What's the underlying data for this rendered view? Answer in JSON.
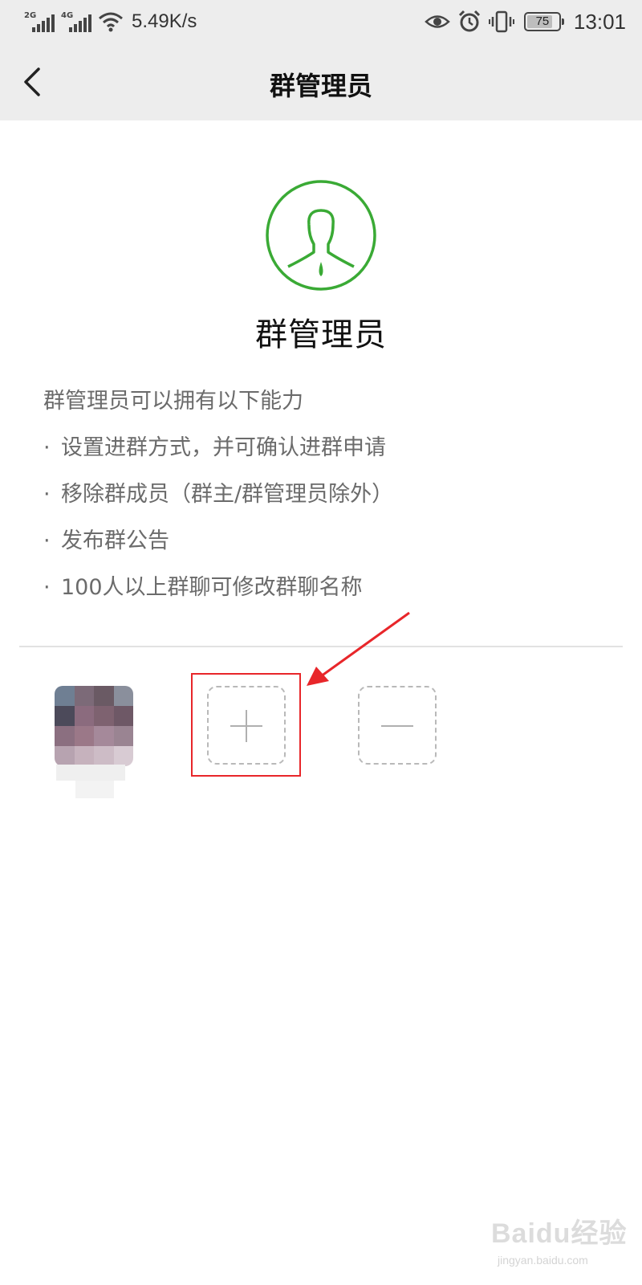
{
  "status_bar": {
    "net1": "2G",
    "net2": "4G",
    "speed": "5.49K/s",
    "battery": "75",
    "time": "13:01",
    "icons": [
      "eye-icon",
      "alarm-icon",
      "vibrate-icon",
      "battery-icon"
    ]
  },
  "nav": {
    "title": "群管理员",
    "back_icon": "chevron-left-icon"
  },
  "hero": {
    "title": "群管理员",
    "accent_color": "#3aaa35"
  },
  "description": {
    "intro": "群管理员可以拥有以下能力",
    "bullet": "·",
    "items": [
      "设置进群方式，并可确认进群申请",
      "移除群成员（群主/群管理员除外）",
      "发布群公告",
      "100人以上群聊可修改群聊名称"
    ]
  },
  "members": {
    "add_icon": "plus-icon",
    "remove_icon": "minus-icon"
  },
  "annotation": {
    "color": "#e8262a"
  },
  "watermark": {
    "logo": "Baidu经验",
    "url": "jingyan.baidu.com"
  }
}
